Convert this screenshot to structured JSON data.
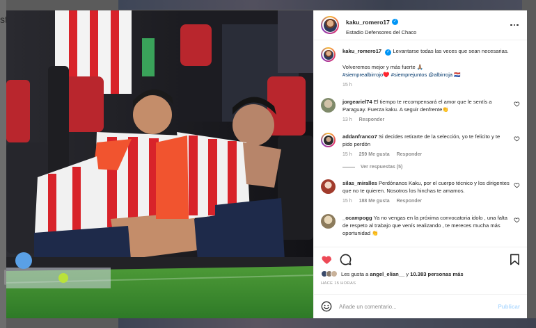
{
  "background": {
    "left_text": "st"
  },
  "post": {
    "author": "kaku_romero17",
    "location": "Estadio Defensores del Chaco",
    "caption": {
      "text": "Levantarse todas las veces que sean necesarias.",
      "line2": "Volveremos mejor y más fuerte 🙏🏽",
      "tags": "#siemprealbirrojo♥️ #siemprejuntos @albirroja 🇵🇾",
      "time": "15 h"
    }
  },
  "comments": [
    {
      "user": "jorgeariel74",
      "text": "El tiempo te recompensará el amor que le sentís a Paraguay. Fuerza kaku. A seguir denfrente👏",
      "time": "13 h",
      "likes": "",
      "reply": "Responder"
    },
    {
      "user": "addanfranco7",
      "text": "Si decides retirarte de la selección, yo te felicito y te pido perdón",
      "time": "15 h",
      "likes": "259 Me gusta",
      "reply": "Responder",
      "view_replies": "Ver respuestas (5)"
    },
    {
      "user": "silas_miralles",
      "text": "Perdónanos Kaku, por el cuerpo técnico y los dirigentes que no te quieren. Nosotros los hinchas te amamos.",
      "time": "15 h",
      "likes": "188 Me gusta",
      "reply": "Responder"
    },
    {
      "user": "_ocampogg",
      "text": "Ya no vengas en la próxima convocatoria idolo , una falta de respeto al trabajo que venís realizando , te mereces mucha más oportunidad 👏",
      "time": "",
      "likes": "",
      "reply": ""
    }
  ],
  "likes": {
    "prefix": "Les gusta a ",
    "user": "angel_elian__",
    "middle": " y ",
    "others": "10.383 personas más"
  },
  "posted_ago": "HACE 15 HORAS",
  "composer": {
    "placeholder": "Añade un comentario...",
    "publish_label": "Publicar"
  },
  "colors": {
    "accent": "#0095f6",
    "like_red": "#ed4956",
    "text": "#262626",
    "muted": "#8e8e8e",
    "tag": "#00376b"
  },
  "icons": [
    "more-options-icon",
    "heart-icon",
    "comment-icon",
    "bookmark-icon",
    "emoji-icon",
    "verified-badge-icon"
  ]
}
